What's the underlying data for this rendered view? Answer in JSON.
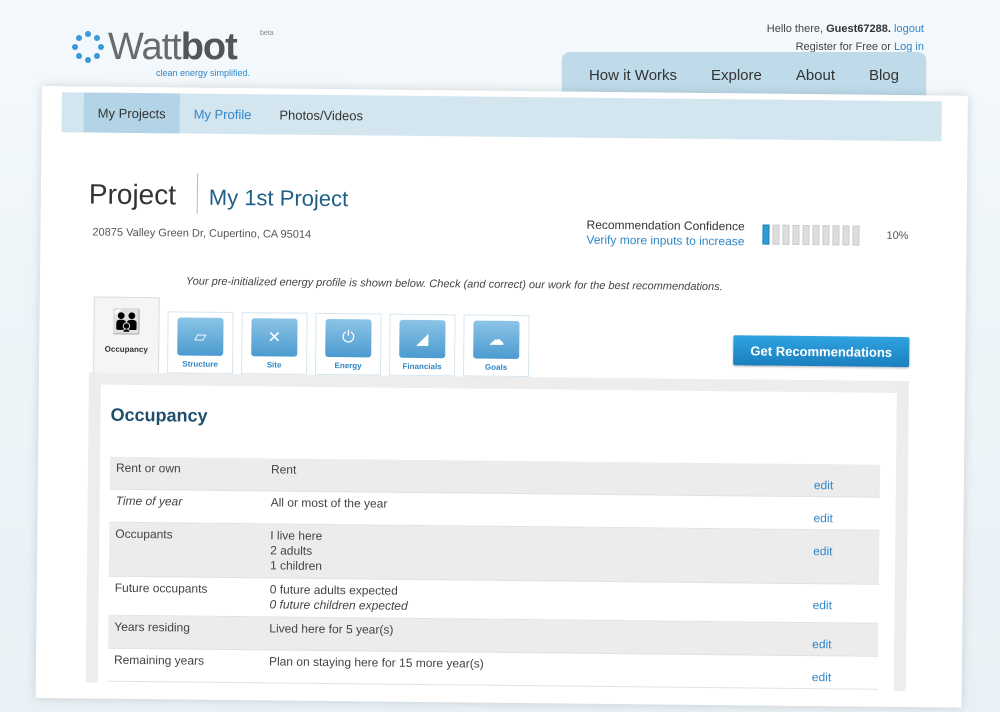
{
  "logo": {
    "name_light": "Watt",
    "name_bold": "bot",
    "beta": "beta",
    "tagline": "clean energy simplified."
  },
  "user": {
    "greeting": "Hello there,",
    "name": "Guest67288.",
    "logout": "logout",
    "register": "Register for Free",
    "or": "or",
    "login": "Log in"
  },
  "topnav": [
    "How it Works",
    "Explore",
    "About",
    "Blog"
  ],
  "subnav": [
    "My Projects",
    "My Profile",
    "Photos/Videos"
  ],
  "project": {
    "label": "Project",
    "name": "My 1st Project",
    "address": "20875 Valley Green Dr, Cupertino, CA 95014"
  },
  "confidence": {
    "title": "Recommendation Confidence",
    "hint": "Verify more inputs to increase",
    "percent_label": "10%",
    "value": 0.1,
    "segments": 10
  },
  "intro": "Your pre-initialized energy profile is shown below. Check (and correct) our work for the best recommendations.",
  "categories": [
    {
      "label": "Occupancy",
      "icon": "people-icon"
    },
    {
      "label": "Structure",
      "icon": "house-icon"
    },
    {
      "label": "Site",
      "icon": "map-icon"
    },
    {
      "label": "Energy",
      "icon": "outlet-icon"
    },
    {
      "label": "Financials",
      "icon": "chart-icon"
    },
    {
      "label": "Goals",
      "icon": "cloud-icon"
    }
  ],
  "get_recommendations": "Get Recommendations",
  "panel": {
    "title": "Occupancy",
    "edit_label": "edit",
    "rows": [
      {
        "key": "Rent or own",
        "lines": [
          "Rent"
        ]
      },
      {
        "key": "Time of year",
        "lines": [
          "All or most of the year"
        ]
      },
      {
        "key": "Occupants",
        "lines": [
          "I live here",
          "2 adults",
          "1 children"
        ]
      },
      {
        "key": "Future occupants",
        "lines": [
          "0 future adults expected",
          "0 future children expected"
        ]
      },
      {
        "key": "Years residing",
        "lines": [
          "Lived here for 5 year(s)"
        ]
      },
      {
        "key": "Remaining years",
        "lines": [
          "Plan on staying here for 15 more year(s)"
        ]
      }
    ]
  },
  "colors": {
    "accent": "#2f86c7",
    "nav_bg": "#bfdbea",
    "subnav_bg": "#d3e6f0",
    "button": "#1b7fbf"
  }
}
